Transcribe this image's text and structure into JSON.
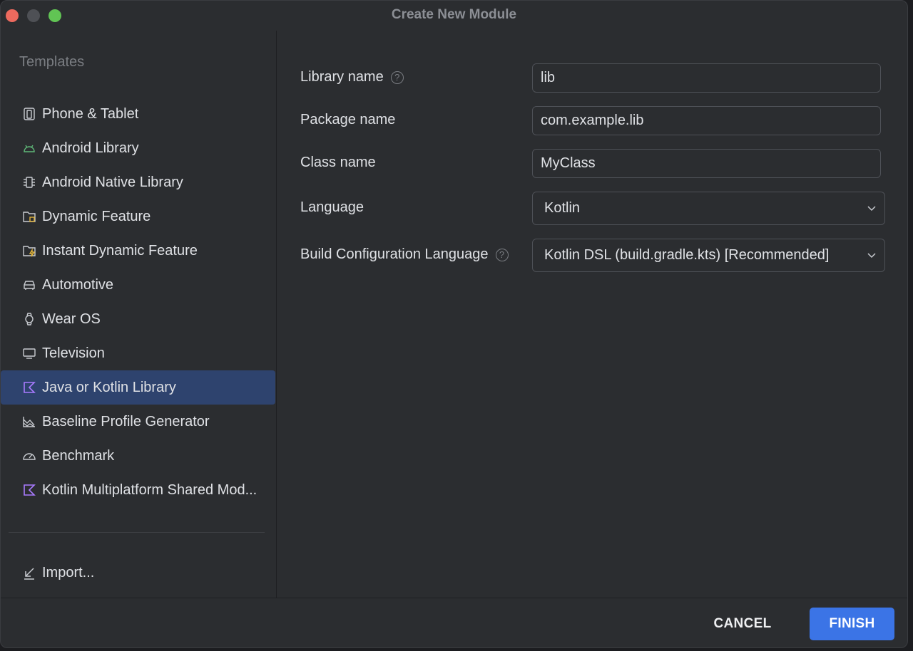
{
  "window": {
    "title": "Create New Module"
  },
  "sidebar": {
    "heading": "Templates",
    "items": [
      {
        "label": "Phone & Tablet",
        "icon": "phone-tablet-icon",
        "selected": false
      },
      {
        "label": "Android Library",
        "icon": "android-icon",
        "selected": false
      },
      {
        "label": "Android Native Library",
        "icon": "native-chip-icon",
        "selected": false
      },
      {
        "label": "Dynamic Feature",
        "icon": "dynamic-feature-folder-icon",
        "selected": false
      },
      {
        "label": "Instant Dynamic Feature",
        "icon": "instant-feature-folder-icon",
        "selected": false
      },
      {
        "label": "Automotive",
        "icon": "car-icon",
        "selected": false
      },
      {
        "label": "Wear OS",
        "icon": "watch-icon",
        "selected": false
      },
      {
        "label": "Television",
        "icon": "tv-icon",
        "selected": false
      },
      {
        "label": "Java or Kotlin Library",
        "icon": "kotlin-icon",
        "selected": true
      },
      {
        "label": "Baseline Profile Generator",
        "icon": "profile-chart-icon",
        "selected": false
      },
      {
        "label": "Benchmark",
        "icon": "gauge-icon",
        "selected": false
      },
      {
        "label": "Kotlin Multiplatform Shared Mod...",
        "icon": "kotlin-icon",
        "selected": false
      }
    ],
    "import_label": "Import..."
  },
  "form": {
    "library_name": {
      "label": "Library name",
      "value": "lib"
    },
    "package_name": {
      "label": "Package name",
      "value": "com.example.lib"
    },
    "class_name": {
      "label": "Class name",
      "value": "MyClass"
    },
    "language": {
      "label": "Language",
      "value": "Kotlin"
    },
    "build_config": {
      "label": "Build Configuration Language",
      "value": "Kotlin DSL (build.gradle.kts) [Recommended]"
    },
    "help_glyph": "?"
  },
  "footer": {
    "cancel_label": "CANCEL",
    "finish_label": "FINISH"
  },
  "colors": {
    "accent": "#3b74e6",
    "selection": "#2e436e",
    "background": "#2b2d30",
    "android_green": "#5fb878",
    "kotlin_purple": "#a97bff"
  }
}
